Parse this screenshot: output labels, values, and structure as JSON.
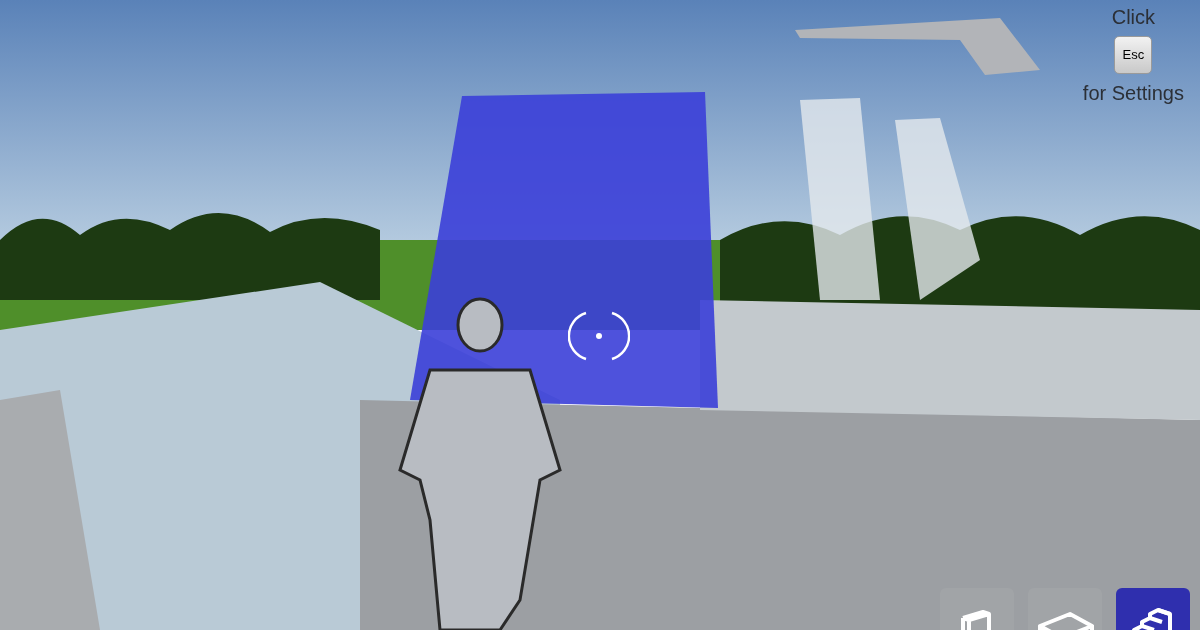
{
  "settings_hint": {
    "top_text": "Click",
    "key": "Esc",
    "bottom_text": "for Settings"
  },
  "build_tools": [
    {
      "kind": "wall",
      "selected": false
    },
    {
      "kind": "floor",
      "selected": false
    },
    {
      "kind": "stairs",
      "selected": true
    }
  ]
}
